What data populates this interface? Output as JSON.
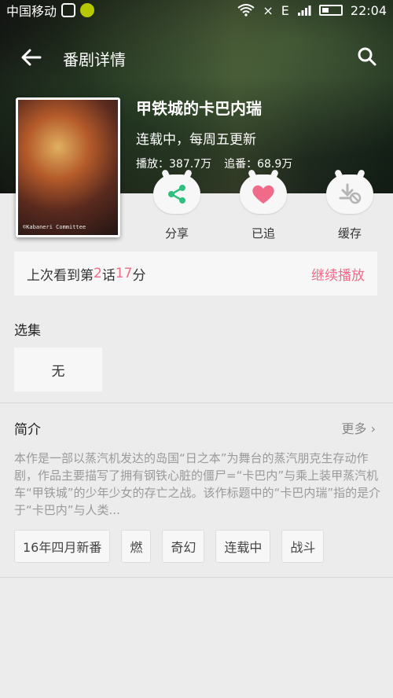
{
  "status_bar": {
    "carrier": "中国移动",
    "network_label": "E",
    "time": "22:04"
  },
  "header": {
    "title": "番剧详情",
    "back_icon": "back-arrow-icon",
    "search_icon": "search-icon"
  },
  "anime": {
    "title": "甲铁城的卡巴内瑞",
    "status": "连载中，每周五更新",
    "plays_label": "播放：387.7万",
    "follows_label": "追番：68.9万",
    "poster_caption": "©Kabaneri Committee"
  },
  "actions": [
    {
      "label": "分享",
      "icon": "share-icon"
    },
    {
      "label": "已追",
      "icon": "heart-icon"
    },
    {
      "label": "缓存",
      "icon": "download-disabled-icon"
    }
  ],
  "last_watch": {
    "prefix": "上次看到第",
    "episode": "2",
    "middle": "话",
    "minute": "17",
    "suffix": "分",
    "continue_label": "继续播放"
  },
  "episodes": {
    "title": "选集",
    "empty_label": "无"
  },
  "intro": {
    "title": "简介",
    "more_label": "更多",
    "text": "本作是一部以蒸汽机发达的岛国“日之本”为舞台的蒸汽朋克生存动作剧，作品主要描写了拥有钢铁心脏的僵尸=“卡巴内”与乘上装甲蒸汽机车“甲铁城”的少年少女的存亡之战。该作标题中的“卡巴内瑞”指的是介于“卡巴内”与人类..."
  },
  "tags": [
    "16年四月新番",
    "燃",
    "奇幻",
    "连载中",
    "战斗"
  ],
  "colors": {
    "accent": "#f06b8a",
    "share_icon": "#2fbf7e",
    "heart_icon": "#f06b8a",
    "background": "#ececec"
  }
}
